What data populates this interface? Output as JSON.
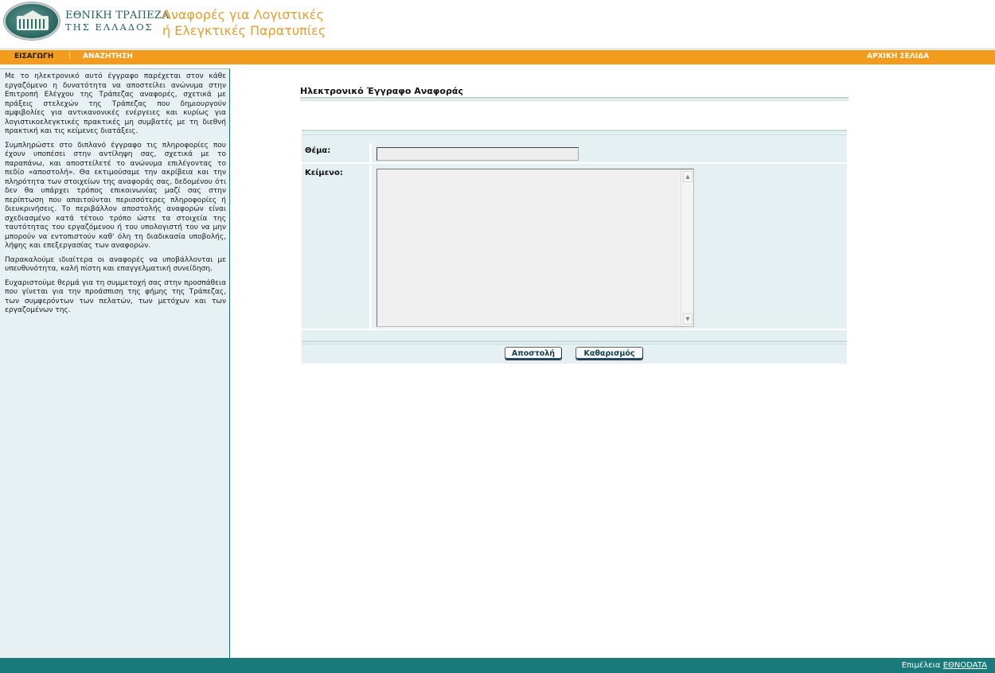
{
  "header": {
    "bank_name_line1": "ΕΘΝΙΚΗ ΤΡΑΠΕΖΑ",
    "bank_name_line2": "ΤΗΣ ΕΛΛΑΔΟΣ",
    "site_title_line1": "Αναφορές για Λογιστικές",
    "site_title_line2": "ή Ελεγκτικές Παρατυπίες"
  },
  "nav": {
    "insert": "ΕΙΣΑΓΩΓΗ",
    "separator": "|",
    "search": "ΑΝΑΖΗΤΗΣΗ",
    "home": "ΑΡΧΙΚΗ ΣΕΛΙΔΑ"
  },
  "sidebar": {
    "paragraphs": [
      "Με το ηλεκτρονικό αυτό έγγραφο παρέχεται στον κάθε εργαζόμενο η δυνατότητα να αποστείλει ανώνυμα στην Επιτροπή Ελέγχου της Τράπεζας αναφορές, σχετικά με πράξεις στελεχών της Τράπεζας που δημιουργούν αμφιβολίες για αντικανονικές ενέργειες και κυρίως για λογιστικοελεγκτικές πρακτικές μη συμβατές με τη διεθνή πρακτική και τις κείμενες διατάξεις.",
      "Συμπληρώστε στο διπλανό έγγραφο τις πληροφορίες που έχουν υποπέσει στην αντίληψη σας, σχετικά με το παραπάνω, και αποστείλετέ το ανώνυμα επιλέγοντας το πεδίο «αποστολή». Θα εκτιμούσαμε την ακρίβεια και την πληρότητα των στοιχείων της αναφοράς σας, δεδομένου ότι δεν θα υπάρχει τρόπος επικοινωνίας μαζί σας στην περίπτωση που απαιτούνται περισσότερες πληροφορίες ή διευκρινήσεις. Το περιβάλλον αποστολής αναφορών είναι σχεδιασμένο κατά τέτοιο τρόπο ώστε τα στοιχεία της ταυτότητας του εργαζόμενου ή του υπολογιστή του να μην μπορούν να εντοπιστούν καθ' όλη τη διαδικασία υποβολής, λήψης και επεξεργασίας των αναφορών.",
      "Παρακαλούμε ιδιαίτερα οι αναφορές να υποβάλλονται με υπευθυνότητα, καλή πίστη και επαγγελματική συνείδηση.",
      "Ευχαριστούμε θερμά για τη συμμετοχή σας στην προσπάθεια που γίνεται για την προάσπιση της φήμης της Τράπεζας, των συμφερόντων των πελατών, των μετόχων και των εργαζομένων της."
    ]
  },
  "form": {
    "title": "Ηλεκτρονικό Έγγραφο Αναφοράς",
    "subject_label": "Θέμα:",
    "subject_value": "",
    "body_label": "Κείμενο:",
    "body_value": "",
    "send_label": "Αποστολή",
    "clear_label": "Καθαρισμός"
  },
  "footer": {
    "prefix": "Επιμέλεια ",
    "link": "ΕΘΝΟDATA"
  },
  "colors": {
    "nav_orange": "#f29b1d",
    "footer_teal": "#1a7a7a",
    "sidebar_bg": "#e7f1f3",
    "title_gold": "#e0a030"
  }
}
